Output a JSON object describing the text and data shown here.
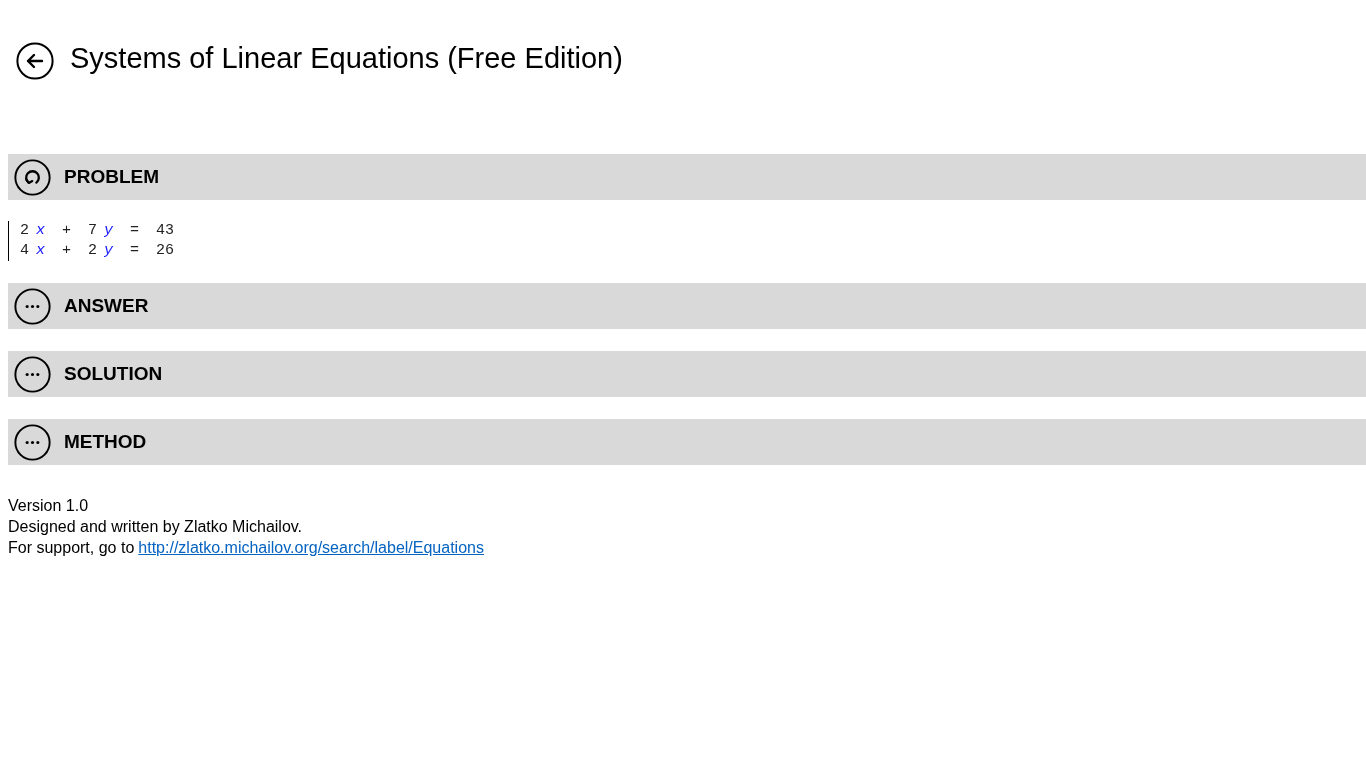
{
  "header": {
    "title": "Systems of Linear Equations (Free Edition)"
  },
  "sections": [
    {
      "kind": "refresh",
      "label": "PROBLEM",
      "equations": [
        {
          "tokens": [
            {
              "kind": "number",
              "text": "2"
            },
            {
              "kind": "variable",
              "text": "x"
            },
            {
              "kind": "operator",
              "text": "+"
            },
            {
              "kind": "number",
              "text": "7"
            },
            {
              "kind": "variable",
              "text": "y"
            },
            {
              "kind": "operator",
              "text": "="
            },
            {
              "kind": "number",
              "text": "43"
            }
          ]
        },
        {
          "tokens": [
            {
              "kind": "number",
              "text": "4"
            },
            {
              "kind": "variable",
              "text": "x"
            },
            {
              "kind": "operator",
              "text": "+"
            },
            {
              "kind": "number",
              "text": "2"
            },
            {
              "kind": "variable",
              "text": "y"
            },
            {
              "kind": "operator",
              "text": "="
            },
            {
              "kind": "number",
              "text": "26"
            }
          ]
        }
      ]
    },
    {
      "kind": "more",
      "label": "ANSWER"
    },
    {
      "kind": "more",
      "label": "SOLUTION"
    },
    {
      "kind": "more",
      "label": "METHOD"
    }
  ],
  "footer": {
    "version": "Version 1.0",
    "credit": "Designed and written by Zlatko Michailov.",
    "support_text": "For support, go to",
    "support_link": "http://zlatko.michailov.org/search/label/Equations"
  }
}
